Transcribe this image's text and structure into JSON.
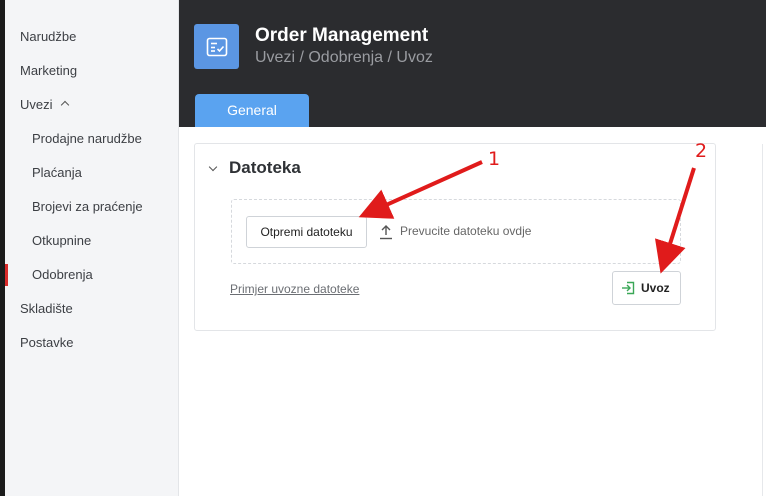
{
  "sidebar": {
    "items": [
      {
        "label": "Narudžbe"
      },
      {
        "label": "Marketing"
      },
      {
        "label": "Uvezi"
      },
      {
        "label": "Prodajne narudžbe"
      },
      {
        "label": "Plaćanja"
      },
      {
        "label": "Brojevi za praćenje"
      },
      {
        "label": "Otkupnine"
      },
      {
        "label": "Odobrenja"
      },
      {
        "label": "Skladište"
      },
      {
        "label": "Postavke"
      }
    ],
    "active_item": "Odobrenja"
  },
  "header": {
    "app_icon": "form-check-icon",
    "title": "Order Management",
    "breadcrumb": "Uvezi / Odobrenja / Uvoz",
    "tabs": [
      {
        "label": "General"
      }
    ]
  },
  "panel": {
    "title": "Datoteka",
    "upload_button": "Otpremi datoteku",
    "drop_text": "Prevucite datoteku ovdje",
    "sample_link": "Primjer uvozne datoteke",
    "import_button": "Uvoz"
  },
  "annotations": {
    "labels": [
      "1",
      "2"
    ],
    "color": "#e01b1b"
  },
  "colors": {
    "accent_blue": "#5aa3f0",
    "header_bg": "#2b2c2f",
    "active_marker": "#d92b2b",
    "import_icon": "#3aa757"
  }
}
